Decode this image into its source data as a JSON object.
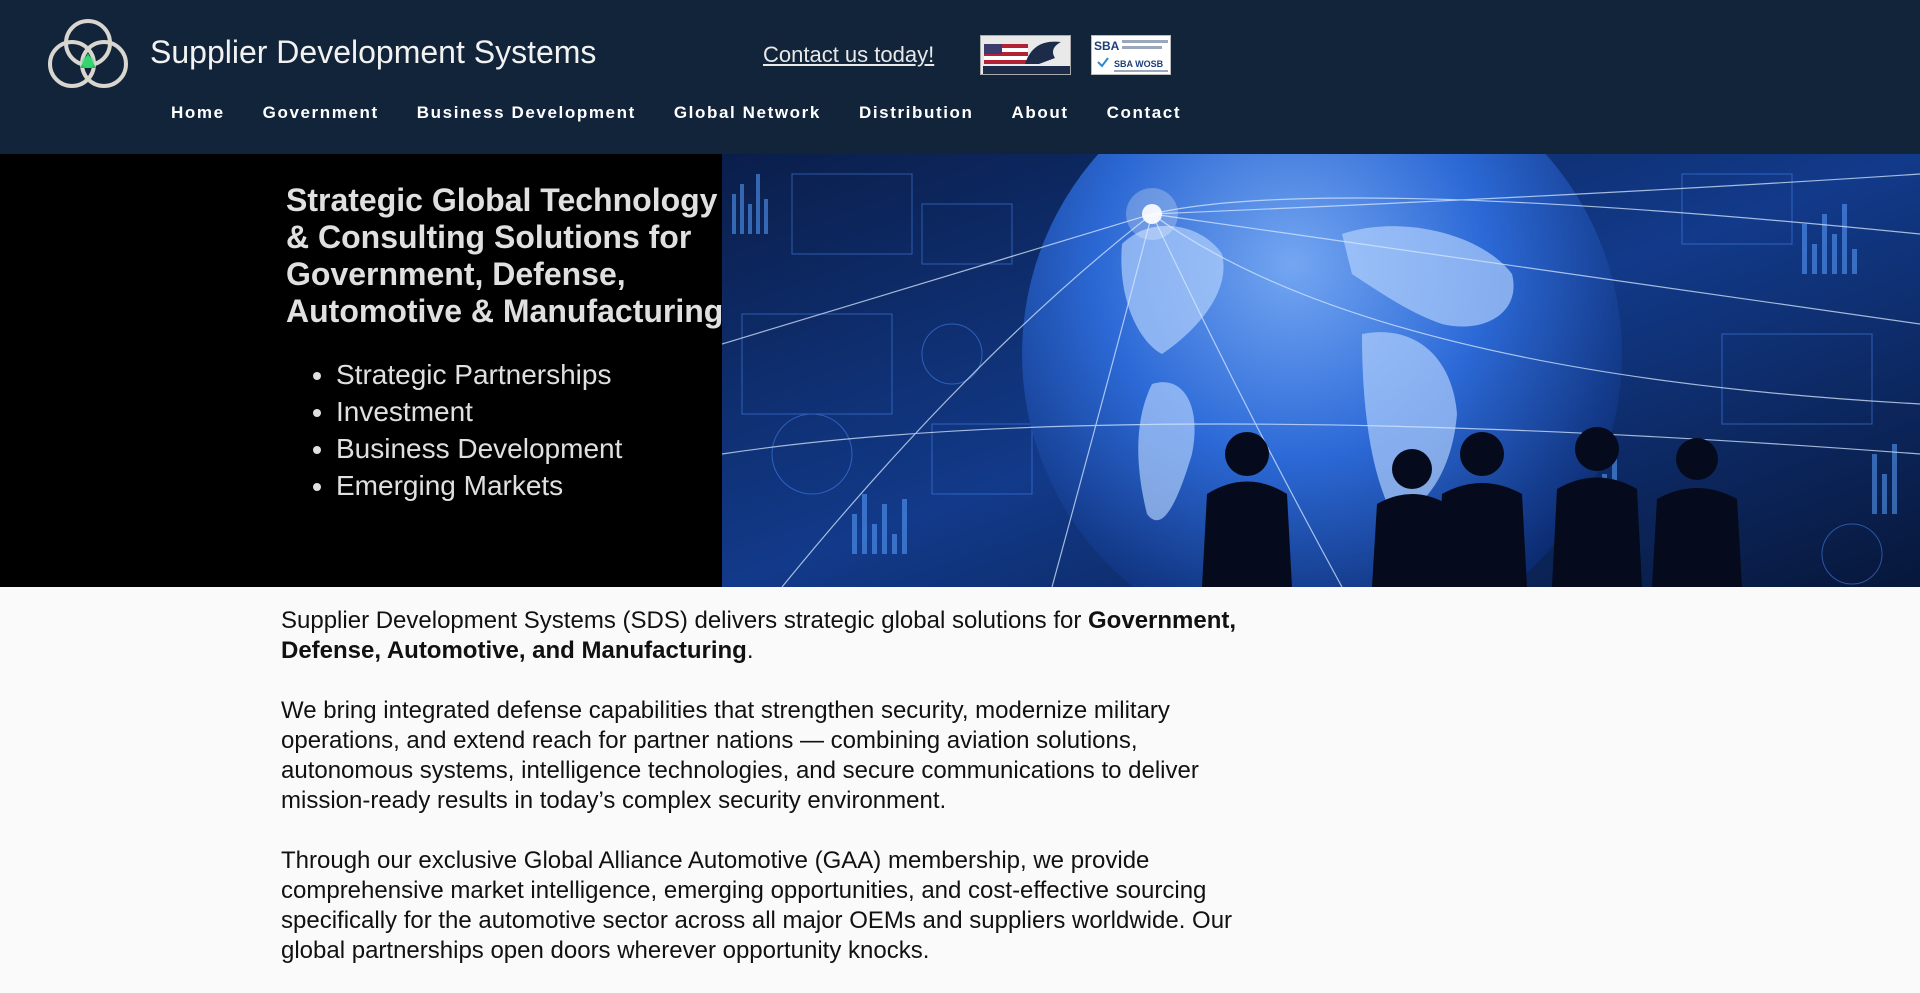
{
  "header": {
    "site_title": "Supplier Development Systems",
    "contact_link": "Contact us today!",
    "badges": {
      "veteran": "VETERAN OWNED BUSINESS",
      "sba_top": "SBA",
      "sba_small": "U.S. Small Business Administration",
      "sba_wosb": "SBA WOSB"
    },
    "nav": [
      "Home",
      "Government",
      "Business Development",
      "Global Network",
      "Distribution",
      "About",
      "Contact"
    ]
  },
  "hero": {
    "heading": "Strategic Global Technology & Consulting Solutions for Government, Defense, Automotive & Manufacturing",
    "bullets": [
      "Strategic Partnerships",
      "Investment",
      "Business Development",
      "Emerging Markets"
    ]
  },
  "content": {
    "p1_start": "Supplier Development Systems (SDS) delivers strategic global solutions for ",
    "p1_bold": "Government, Defense, Automotive, and Manufacturing",
    "p1_end": ".",
    "p2": "We bring integrated defense capabilities that strengthen security, modernize military operations, and extend reach for partner nations — combining aviation solutions, autonomous systems, intelligence technologies, and secure communications to deliver mission-ready results in today’s complex security environment.",
    "p3": "Through our exclusive Global Alliance Automotive (GAA) membership, we provide comprehensive market intelligence, emerging opportunities, and cost-effective sourcing specifically for the automotive sector across all major OEMs and suppliers worldwide. Our global partnerships open doors wherever opportunity knocks."
  },
  "colors": {
    "header_bg": "#12243a",
    "hero_bg": "#000000",
    "page_bg": "#fafafa",
    "accent_green": "#22c55e",
    "globe_blue": "#2f6fe0"
  }
}
